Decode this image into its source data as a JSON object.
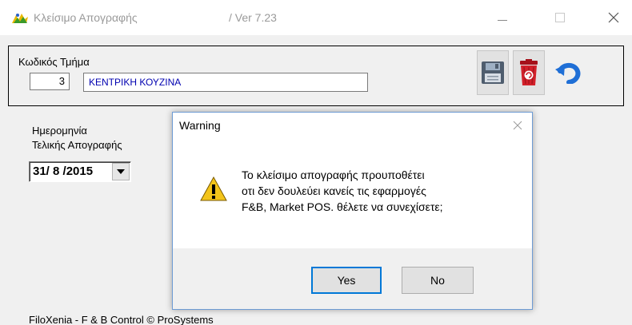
{
  "window": {
    "title": "Κλείσιμο Απογραφής",
    "version": "/  Ver  7.23",
    "colors": {
      "accent": "#0078d7",
      "dept_text": "#0000b0"
    }
  },
  "form": {
    "code_label": "Κωδικός",
    "dept_label": "Τμήμα",
    "code_value": "3",
    "dept_value": "ΚΕΝΤΡΙΚΗ ΚΟΥΖΙΝΑ",
    "date_label_line1": "Ημερομηνία",
    "date_label_line2": "Τελικής Απογραφής",
    "date_value": "31/ 8 /2015"
  },
  "toolbar": {
    "icons": [
      "save-icon",
      "delete-icon",
      "undo-icon"
    ]
  },
  "status": {
    "text": "FiloXenia - F & B Control  © ProSystems"
  },
  "dialog": {
    "title": "Warning",
    "message_lines": [
      "Το κλείσιμο απογραφής προυποθέτει",
      "οτι δεν δουλεύει κανείς τις εφαρμογές",
      "F&B, Market POS. θέλετε να συνεχίσετε;"
    ],
    "yes_label": "Yes",
    "no_label": "No",
    "icon": "warning-icon"
  }
}
